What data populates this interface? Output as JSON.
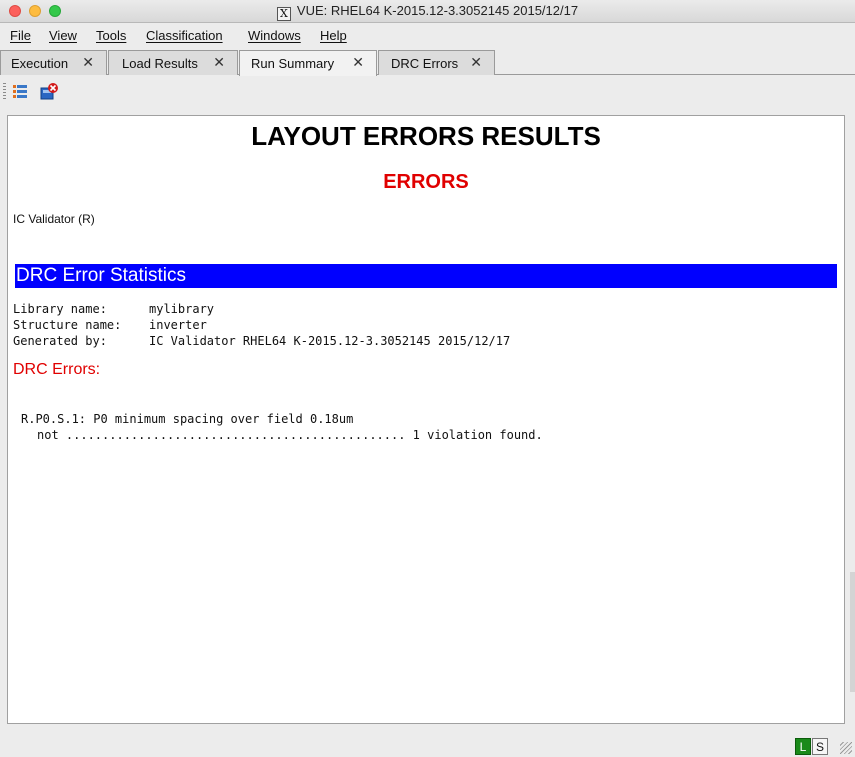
{
  "window": {
    "title": "VUE:  RHEL64 K-2015.12-3.3052145 2015/12/17",
    "x_icon_glyph": "X"
  },
  "menu": [
    {
      "label": "File"
    },
    {
      "label": "View"
    },
    {
      "label": "Tools"
    },
    {
      "label": "Classification"
    },
    {
      "label": "Windows"
    },
    {
      "label": "Help"
    }
  ],
  "tabs": [
    {
      "label": "Execution",
      "active": false
    },
    {
      "label": "Load Results",
      "active": false
    },
    {
      "label": "Run Summary",
      "active": true
    },
    {
      "label": "DRC Errors",
      "active": false
    }
  ],
  "tab_close_glyph": "✕",
  "toolbar": {
    "icons": [
      "list-view-icon",
      "close-report-icon"
    ]
  },
  "report": {
    "title": "LAYOUT ERRORS RESULTS",
    "status_heading": "ERRORS",
    "tool": "IC Validator (R)",
    "section_title": "DRC Error Statistics",
    "info": [
      {
        "label": "Library name:",
        "value": "mylibrary"
      },
      {
        "label": "Structure name:",
        "value": "inverter"
      },
      {
        "label": "Generated by:",
        "value": "IC Validator RHEL64 K-2015.12-3.3052145 2015/12/17"
      }
    ],
    "drc_errors_label": "DRC Errors:",
    "rule_line": "R.P0.S.1: P0 minimum spacing over field 0.18um",
    "violation_line": "not ............................................... 1 violation found."
  },
  "status": {
    "left_badge": "L",
    "right_badge": "S"
  },
  "colors": {
    "section_bar": "#0000ff",
    "error_red": "#e00000",
    "status_green": "#1a8a1a"
  }
}
